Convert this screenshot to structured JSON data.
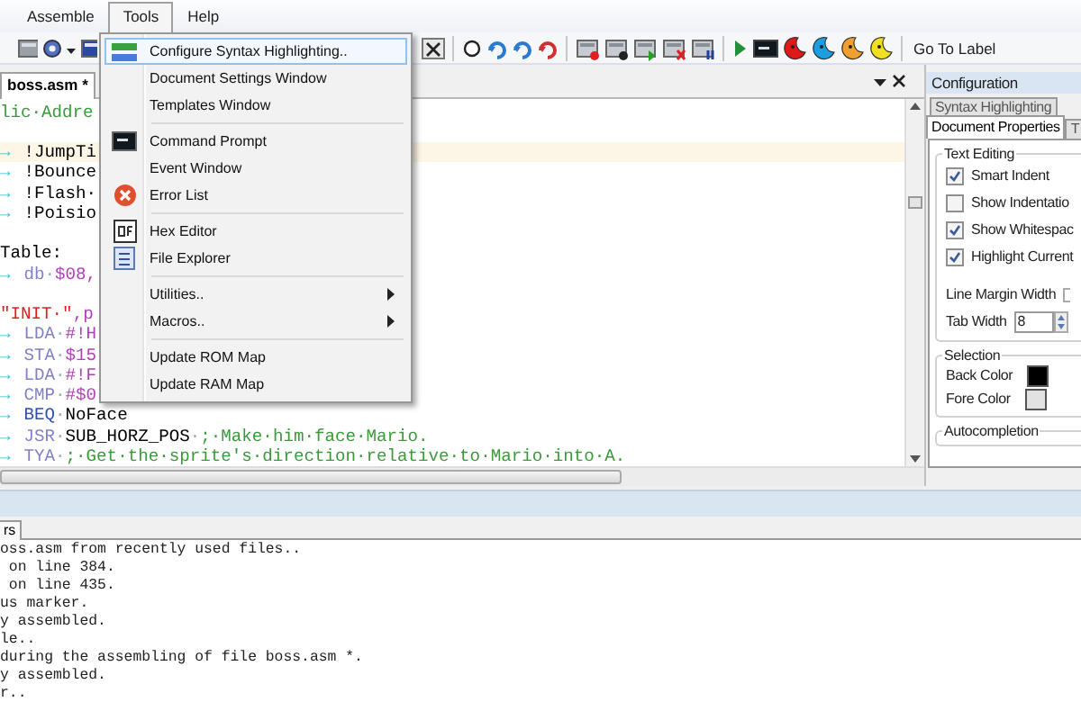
{
  "menu_bar": [
    {
      "label": "Assemble",
      "selected": false
    },
    {
      "label": "Tools",
      "selected": true
    },
    {
      "label": "Help",
      "selected": false
    }
  ],
  "toolbar": {
    "go_to_label": "Go To Label"
  },
  "editor": {
    "tab": {
      "label": "boss.asm *",
      "selected": true
    },
    "lines": [
      {
        "current": false,
        "segments": [
          {
            "kind": "comment",
            "text": "lic·Addre"
          }
        ]
      },
      {
        "current": false
      },
      {
        "current": true,
        "segments": [
          {
            "kind": "tab",
            "text": "→"
          },
          {
            "kind": "plain",
            "text": "!JumpTi"
          }
        ]
      },
      {
        "current": false,
        "segments": [
          {
            "kind": "tab",
            "text": "→"
          },
          {
            "kind": "plain",
            "text": "!Bounce"
          }
        ]
      },
      {
        "current": false,
        "segments": [
          {
            "kind": "tab",
            "text": "→"
          },
          {
            "kind": "plain",
            "text": "!Flash·"
          }
        ]
      },
      {
        "current": false,
        "segments": [
          {
            "kind": "tab",
            "text": "→"
          },
          {
            "kind": "plain",
            "text": "!Poisio"
          }
        ]
      },
      {
        "current": false
      },
      {
        "current": false,
        "segments": [
          {
            "kind": "plain",
            "text": "Table:"
          }
        ]
      },
      {
        "current": false,
        "segments": [
          {
            "kind": "tab",
            "text": "→"
          },
          {
            "kind": "opcode",
            "text": "db"
          },
          {
            "kind": "space",
            "text": "·"
          },
          {
            "kind": "number",
            "text": "$08,"
          }
        ]
      },
      {
        "current": false
      },
      {
        "current": false,
        "segments": [
          {
            "kind": "string",
            "text": "\"INIT·\""
          },
          {
            "kind": "number",
            "text": ",p"
          }
        ]
      },
      {
        "current": false,
        "segments": [
          {
            "kind": "tab",
            "text": "→"
          },
          {
            "kind": "opcode",
            "text": "LDA"
          },
          {
            "kind": "space",
            "text": "·"
          },
          {
            "kind": "number",
            "text": "#!H"
          }
        ]
      },
      {
        "current": false,
        "segments": [
          {
            "kind": "tab",
            "text": "→"
          },
          {
            "kind": "opcode",
            "text": "STA"
          },
          {
            "kind": "space",
            "text": "·"
          },
          {
            "kind": "number",
            "text": "$15"
          }
        ]
      },
      {
        "current": false,
        "segments": [
          {
            "kind": "tab",
            "text": "→"
          },
          {
            "kind": "opcode",
            "text": "LDA"
          },
          {
            "kind": "space",
            "text": "·"
          },
          {
            "kind": "number",
            "text": "#!F"
          }
        ]
      },
      {
        "current": false,
        "segments": [
          {
            "kind": "tab",
            "text": "→"
          },
          {
            "kind": "opcode",
            "text": "CMP"
          },
          {
            "kind": "space",
            "text": "·"
          },
          {
            "kind": "number",
            "text": "#$0"
          }
        ]
      },
      {
        "current": false,
        "segments": [
          {
            "kind": "tab",
            "text": "→"
          },
          {
            "kind": "branch",
            "text": "BEQ"
          },
          {
            "kind": "space",
            "text": "·"
          },
          {
            "kind": "plain",
            "text": "NoFace"
          }
        ]
      },
      {
        "current": false,
        "segments": [
          {
            "kind": "tab",
            "text": "→"
          },
          {
            "kind": "opcode",
            "text": "JSR"
          },
          {
            "kind": "space",
            "text": "·"
          },
          {
            "kind": "plain",
            "text": "SUB_HORZ_POS"
          },
          {
            "kind": "space",
            "text": "·"
          },
          {
            "kind": "comment",
            "text": ";·Make·him·face·Mario."
          }
        ]
      },
      {
        "current": false,
        "segments": [
          {
            "kind": "tab",
            "text": "→"
          },
          {
            "kind": "opcode",
            "text": "TYA"
          },
          {
            "kind": "space",
            "text": "·"
          },
          {
            "kind": "comment",
            "text": ";·Get·the·sprite's·direction·relative·to·Mario·into·A."
          }
        ]
      }
    ]
  },
  "tools_menu": [
    {
      "kind": "item",
      "label": "Configure Syntax Highlighting..",
      "selected": true
    },
    {
      "kind": "item",
      "label": "Document Settings Window",
      "selected": false
    },
    {
      "kind": "item",
      "label": "Templates Window",
      "selected": false
    },
    {
      "kind": "separator"
    },
    {
      "kind": "item",
      "label": "Command Prompt",
      "selected": false
    },
    {
      "kind": "item",
      "label": "Event Window",
      "selected": false
    },
    {
      "kind": "item",
      "label": "Error List",
      "selected": false
    },
    {
      "kind": "separator"
    },
    {
      "kind": "item",
      "label": "Hex Editor",
      "selected": false
    },
    {
      "kind": "item",
      "label": "File Explorer",
      "selected": false
    },
    {
      "kind": "separator"
    },
    {
      "kind": "submenu",
      "label": "Utilities..",
      "selected": false
    },
    {
      "kind": "submenu",
      "label": "Macros..",
      "selected": false
    },
    {
      "kind": "separator"
    },
    {
      "kind": "item",
      "label": "Update ROM Map",
      "selected": false
    },
    {
      "kind": "item",
      "label": "Update RAM Map",
      "selected": false
    }
  ],
  "configuration": {
    "title": "Configuration",
    "tab_rows": [
      [
        {
          "label": "Syntax Highlighting",
          "selected": false
        }
      ],
      [
        {
          "label": "Document Properties",
          "selected": true
        },
        {
          "label": "T",
          "selected": false
        }
      ]
    ],
    "text_editing": {
      "title": "Text Editing",
      "options": [
        {
          "label": "Smart Indent",
          "checked": true
        },
        {
          "label": "Show Indentatio",
          "checked": false
        },
        {
          "label": "Show Whitespac",
          "checked": true
        },
        {
          "label": "Highlight Current",
          "checked": true
        }
      ]
    },
    "line_margin_width": {
      "label": "Line Margin Width"
    },
    "tab_width": {
      "label": "Tab Width",
      "value": "8"
    },
    "selection": {
      "title": "Selection",
      "colors": [
        {
          "label": "Back Color",
          "color": "#000000"
        },
        {
          "label": "Fore Color",
          "color": "#e2e2e2"
        }
      ]
    },
    "autocompletion": {
      "title": "Autocompletion"
    }
  },
  "output": {
    "tab": {
      "label": "rs",
      "selected": true
    },
    "lines": [
      "oss.asm from recently used files..",
      " on line 384.",
      " on line 435.",
      "us marker.",
      "y assembled.",
      "le..",
      "during the assembling of file boss.asm *.",
      "y assembled.",
      "r.."
    ]
  }
}
